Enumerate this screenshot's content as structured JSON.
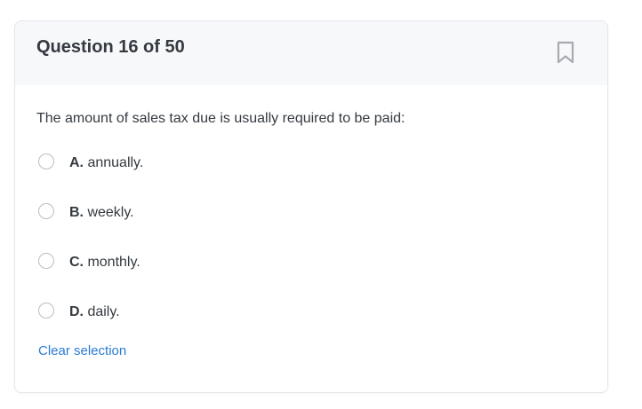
{
  "header": {
    "title": "Question 16 of 50",
    "bookmark_icon": "bookmark-icon"
  },
  "question": {
    "text": "The amount of sales tax due is usually required to be paid:"
  },
  "options": [
    {
      "letter": "A.",
      "text": "annually."
    },
    {
      "letter": "B.",
      "text": "weekly."
    },
    {
      "letter": "C.",
      "text": "monthly."
    },
    {
      "letter": "D.",
      "text": "daily."
    }
  ],
  "clear_label": "Clear selection",
  "colors": {
    "text": "#343a40",
    "header_bg": "#f7f8fa",
    "link": "#2b7cd3",
    "radio_border": "#b9bec4",
    "icon": "#a6abb1"
  }
}
